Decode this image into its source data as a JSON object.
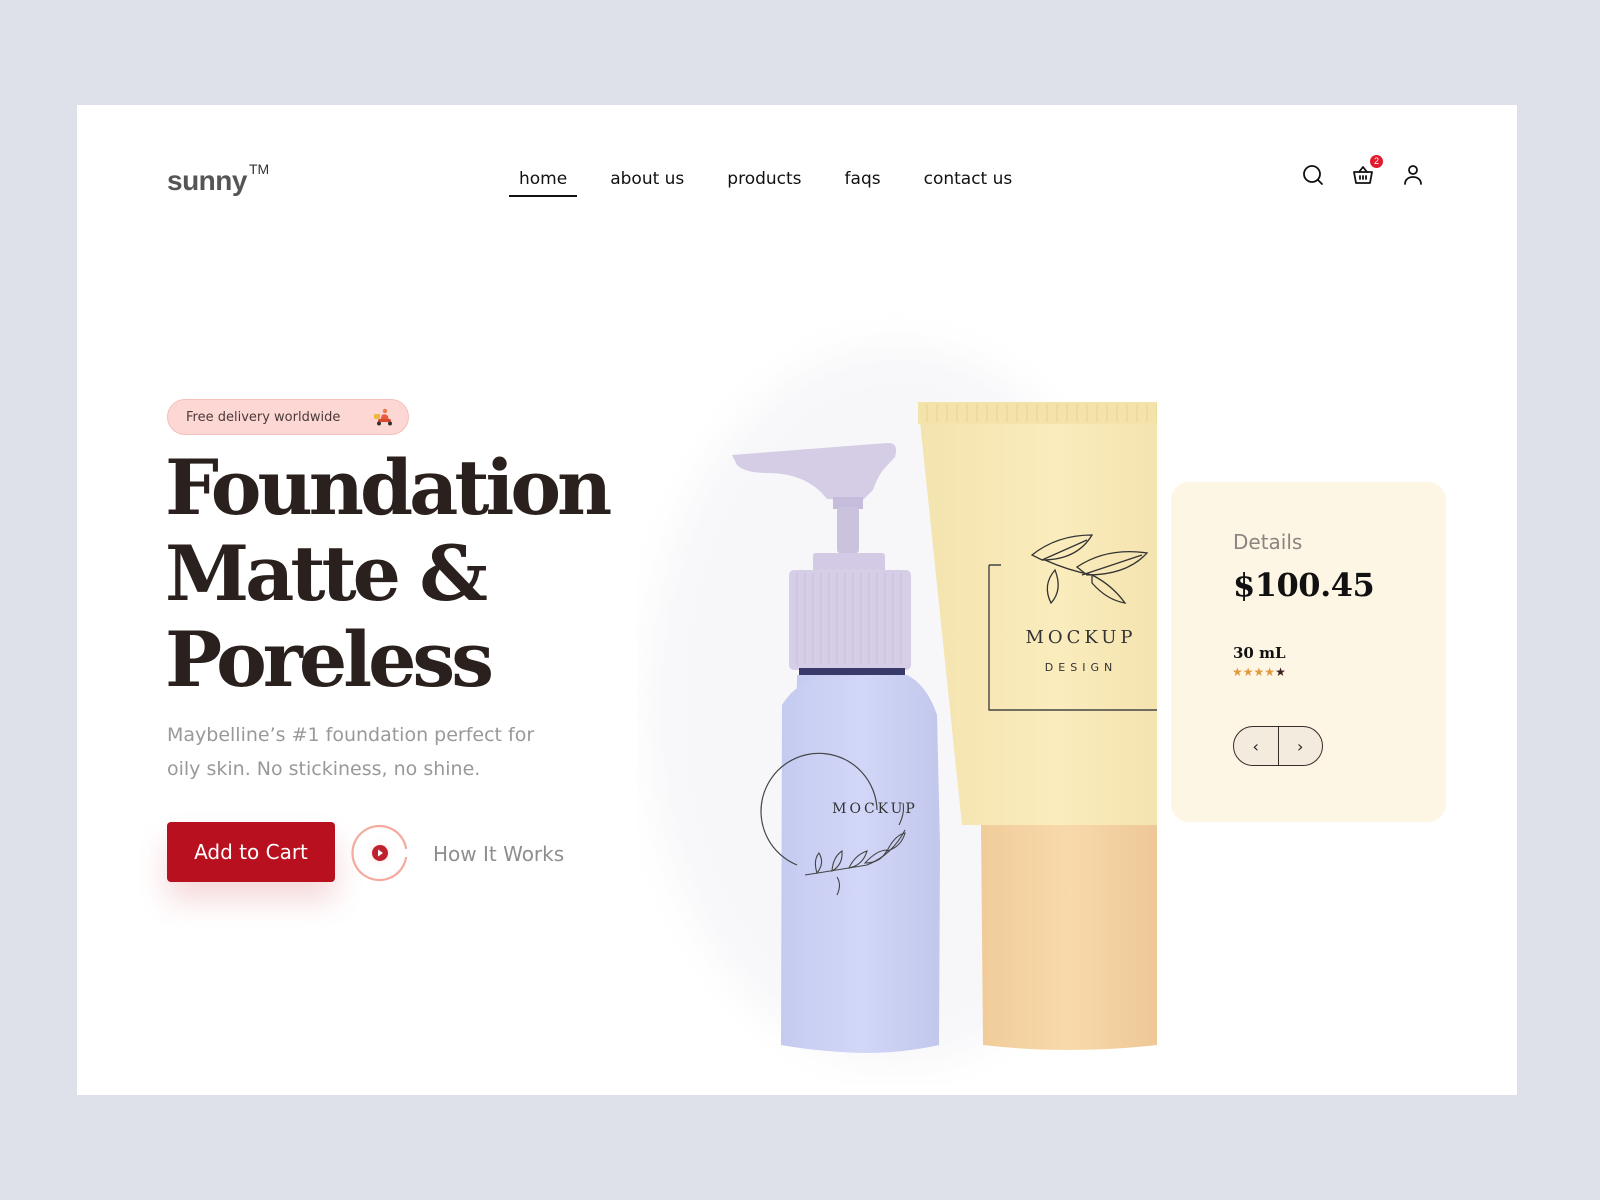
{
  "brand": {
    "name": "sunny",
    "trademark": "TM"
  },
  "nav": {
    "items": [
      {
        "label": "home",
        "active": true
      },
      {
        "label": "about us",
        "active": false
      },
      {
        "label": "products",
        "active": false
      },
      {
        "label": "faqs",
        "active": false
      },
      {
        "label": "contact us",
        "active": false
      }
    ]
  },
  "header_icons": {
    "search": "search-icon",
    "cart": "basket-icon",
    "cart_count": "2",
    "account": "user-icon"
  },
  "hero": {
    "promo_pill": "Free delivery worldwide",
    "headline": [
      "Foundation",
      "Matte &",
      "Poreless"
    ],
    "subtitle": "Maybelline’s #1 foundation perfect for oily skin. No stickiness, no shine.",
    "cta_label": "Add to Cart",
    "secondary_label": "How It Works"
  },
  "products": {
    "bottle_label": "MOCKUP",
    "tube_label": "MOCKUP",
    "tube_sublabel": "DESIGN"
  },
  "details": {
    "label": "Details",
    "price": "$100.45",
    "size": "30 mL",
    "rating": 4,
    "rating_max": 5,
    "prev_label": "‹",
    "next_label": "›"
  },
  "colors": {
    "accent": "#b8101f",
    "badge": "#e3192e",
    "card_bg": "#fdf6e4",
    "pill_bg": "#fdd7d4",
    "star": "#e39a3c",
    "page_bg": "#dee1e9"
  }
}
